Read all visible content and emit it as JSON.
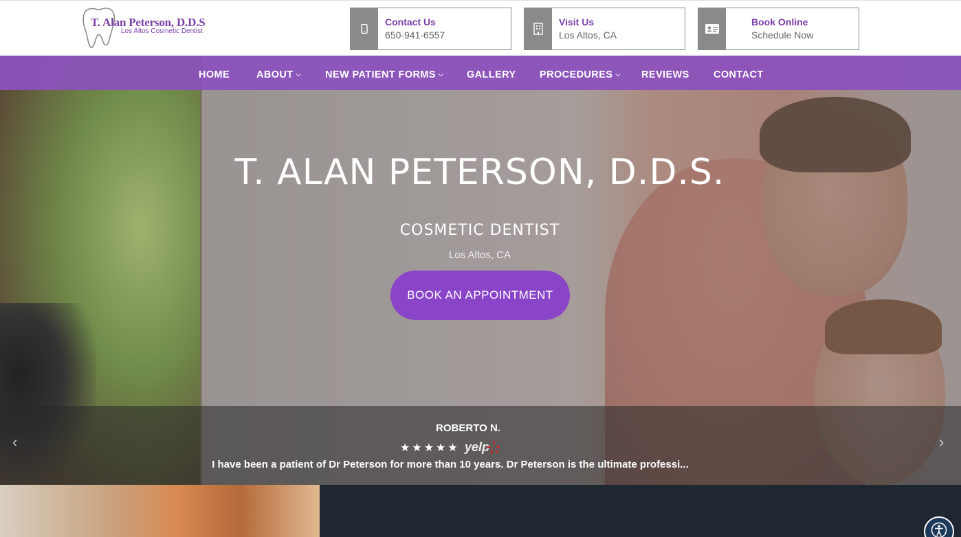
{
  "header": {
    "logo_name": "T. Alan Peterson, D.D.S",
    "logo_tagline": "Los Altos Cosmetic Dentist",
    "contact": {
      "title": "Contact Us",
      "value": "650-941-6557",
      "icon": "phone-icon"
    },
    "visit": {
      "title": "Visit Us",
      "value": "Los Altos, CA",
      "icon": "building-icon"
    },
    "book": {
      "title": "Book Online",
      "value": "Schedule Now",
      "icon": "id-card-icon"
    }
  },
  "nav": {
    "items": [
      {
        "label": "HOME",
        "has_dropdown": false
      },
      {
        "label": "ABOUT",
        "has_dropdown": true
      },
      {
        "label": "NEW PATIENT FORMS",
        "has_dropdown": true
      },
      {
        "label": "GALLERY",
        "has_dropdown": false
      },
      {
        "label": "PROCEDURES",
        "has_dropdown": true
      },
      {
        "label": "REVIEWS",
        "has_dropdown": false
      },
      {
        "label": "CONTACT",
        "has_dropdown": false
      }
    ]
  },
  "hero": {
    "title": "T. ALAN PETERSON, D.D.S.",
    "subtitle": "COSMETIC DENTIST",
    "location": "Los Altos, CA",
    "cta_label": "BOOK AN APPOINTMENT"
  },
  "review": {
    "name": "ROBERTO N.",
    "stars": 5,
    "source": "yelp",
    "text": "I have been a patient of Dr Peterson for more than 10 years. Dr Peterson is the ultimate professi..."
  },
  "colors": {
    "brand_purple": "#7b3fa8",
    "nav_purple": "#8c50be",
    "cta_purple": "#8a44c8",
    "dark_section": "#1f2730"
  }
}
